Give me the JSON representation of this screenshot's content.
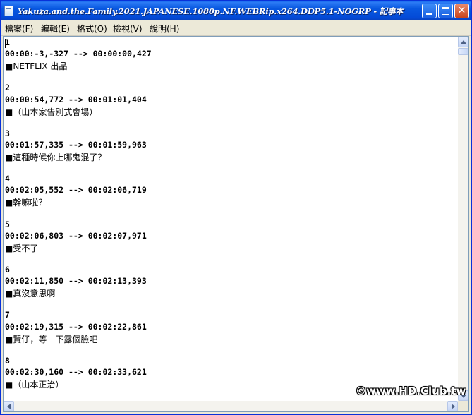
{
  "window": {
    "title": "Yakuza.and.the.Family.2021.JAPANESE.1080p.NF.WEBRip.x264.DDP5.1-NOGRP - 記事本"
  },
  "menu": [
    {
      "label": "檔案(F)"
    },
    {
      "label": "編輯(E)"
    },
    {
      "label": "格式(O)"
    },
    {
      "label": "檢視(V)"
    },
    {
      "label": "說明(H)"
    }
  ],
  "lines": [
    "1",
    "00:00:-3,-327 --> 00:00:00,427",
    "■NETFLIX 出品",
    "",
    "2",
    "00:00:54,772 --> 00:01:01,404",
    "■（山本家告別式會場）",
    "",
    "3",
    "00:01:57,335 --> 00:01:59,963",
    "■這種時候你上哪鬼混了？",
    "",
    "4",
    "00:02:05,552 --> 00:02:06,719",
    "■幹嘛啦？",
    "",
    "5",
    "00:02:06,803 --> 00:02:07,971",
    "■受不了",
    "",
    "6",
    "00:02:11,850 --> 00:02:13,393",
    "■真沒意思啊",
    "",
    "7",
    "00:02:19,315 --> 00:02:22,861",
    "■賢仔，等一下露個臉吧",
    "",
    "8",
    "00:02:30,160 --> 00:02:33,621",
    "■（山本正治）"
  ],
  "watermark": "©www.HD.Club.tw",
  "colors": {
    "titlebar": "#0858e0",
    "close_button": "#c9431c",
    "editor_bg": "#ffffff"
  }
}
